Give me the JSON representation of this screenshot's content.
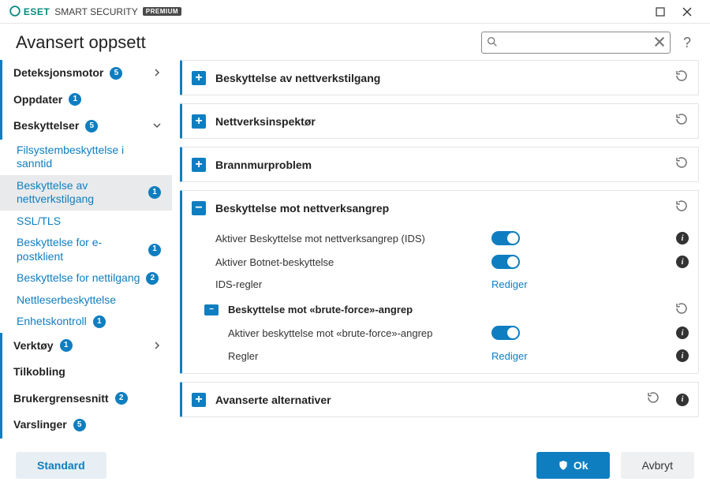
{
  "brand": {
    "eset": "ESET",
    "product": "SMART SECURITY",
    "edition": "PREMIUM"
  },
  "page_title": "Avansert oppsett",
  "search": {
    "placeholder": ""
  },
  "help_label": "?",
  "sidebar": {
    "items": [
      {
        "label": "Deteksjonsmotor",
        "count": "5",
        "expandable": true
      },
      {
        "label": "Oppdater",
        "count": "1"
      },
      {
        "label": "Beskyttelser",
        "count": "5",
        "expandable": true,
        "children": [
          {
            "label": "Filsystembeskyttelse i sanntid"
          },
          {
            "label": "Beskyttelse av nettverkstilgang",
            "count": "1",
            "selected": true
          },
          {
            "label": "SSL/TLS"
          },
          {
            "label": "Beskyttelse for e-postklient",
            "count": "1"
          },
          {
            "label": "Beskyttelse for nettilgang",
            "count": "2"
          },
          {
            "label": "Nettleserbeskyttelse"
          },
          {
            "label": "Enhetskontroll",
            "count": "1"
          }
        ]
      },
      {
        "label": "Verktøy",
        "count": "1",
        "expandable": true
      },
      {
        "label": "Tilkobling"
      },
      {
        "label": "Brukergrensesnitt",
        "count": "2"
      },
      {
        "label": "Varslinger",
        "count": "5"
      }
    ]
  },
  "panels": [
    {
      "title": "Beskyttelse av nettverkstilgang",
      "expanded": false
    },
    {
      "title": "Nettverksinspektør",
      "expanded": false
    },
    {
      "title": "Brannmurproblem",
      "expanded": false
    },
    {
      "title": "Beskyttelse mot nettverksangrep",
      "expanded": true,
      "rows": [
        {
          "label": "Aktiver Beskyttelse mot nettverksangrep (IDS)",
          "type": "toggle",
          "on": true,
          "info": true
        },
        {
          "label": "Aktiver Botnet-beskyttelse",
          "type": "toggle",
          "on": true,
          "info": true
        },
        {
          "label": "IDS-regler",
          "type": "link",
          "action": "Rediger"
        }
      ],
      "sub": {
        "title": "Beskyttelse mot «brute-force»-angrep",
        "rows": [
          {
            "label": "Aktiver beskyttelse mot «brute-force»-angrep",
            "type": "toggle",
            "on": true,
            "info": true
          },
          {
            "label": "Regler",
            "type": "link",
            "action": "Rediger",
            "info": true
          }
        ]
      }
    },
    {
      "title": "Avanserte alternativer",
      "expanded": false,
      "has_info": true,
      "has_reset": true
    }
  ],
  "footer": {
    "default": "Standard",
    "ok": "Ok",
    "cancel": "Avbryt"
  },
  "icons": {
    "plus": "+",
    "minus": "−"
  }
}
